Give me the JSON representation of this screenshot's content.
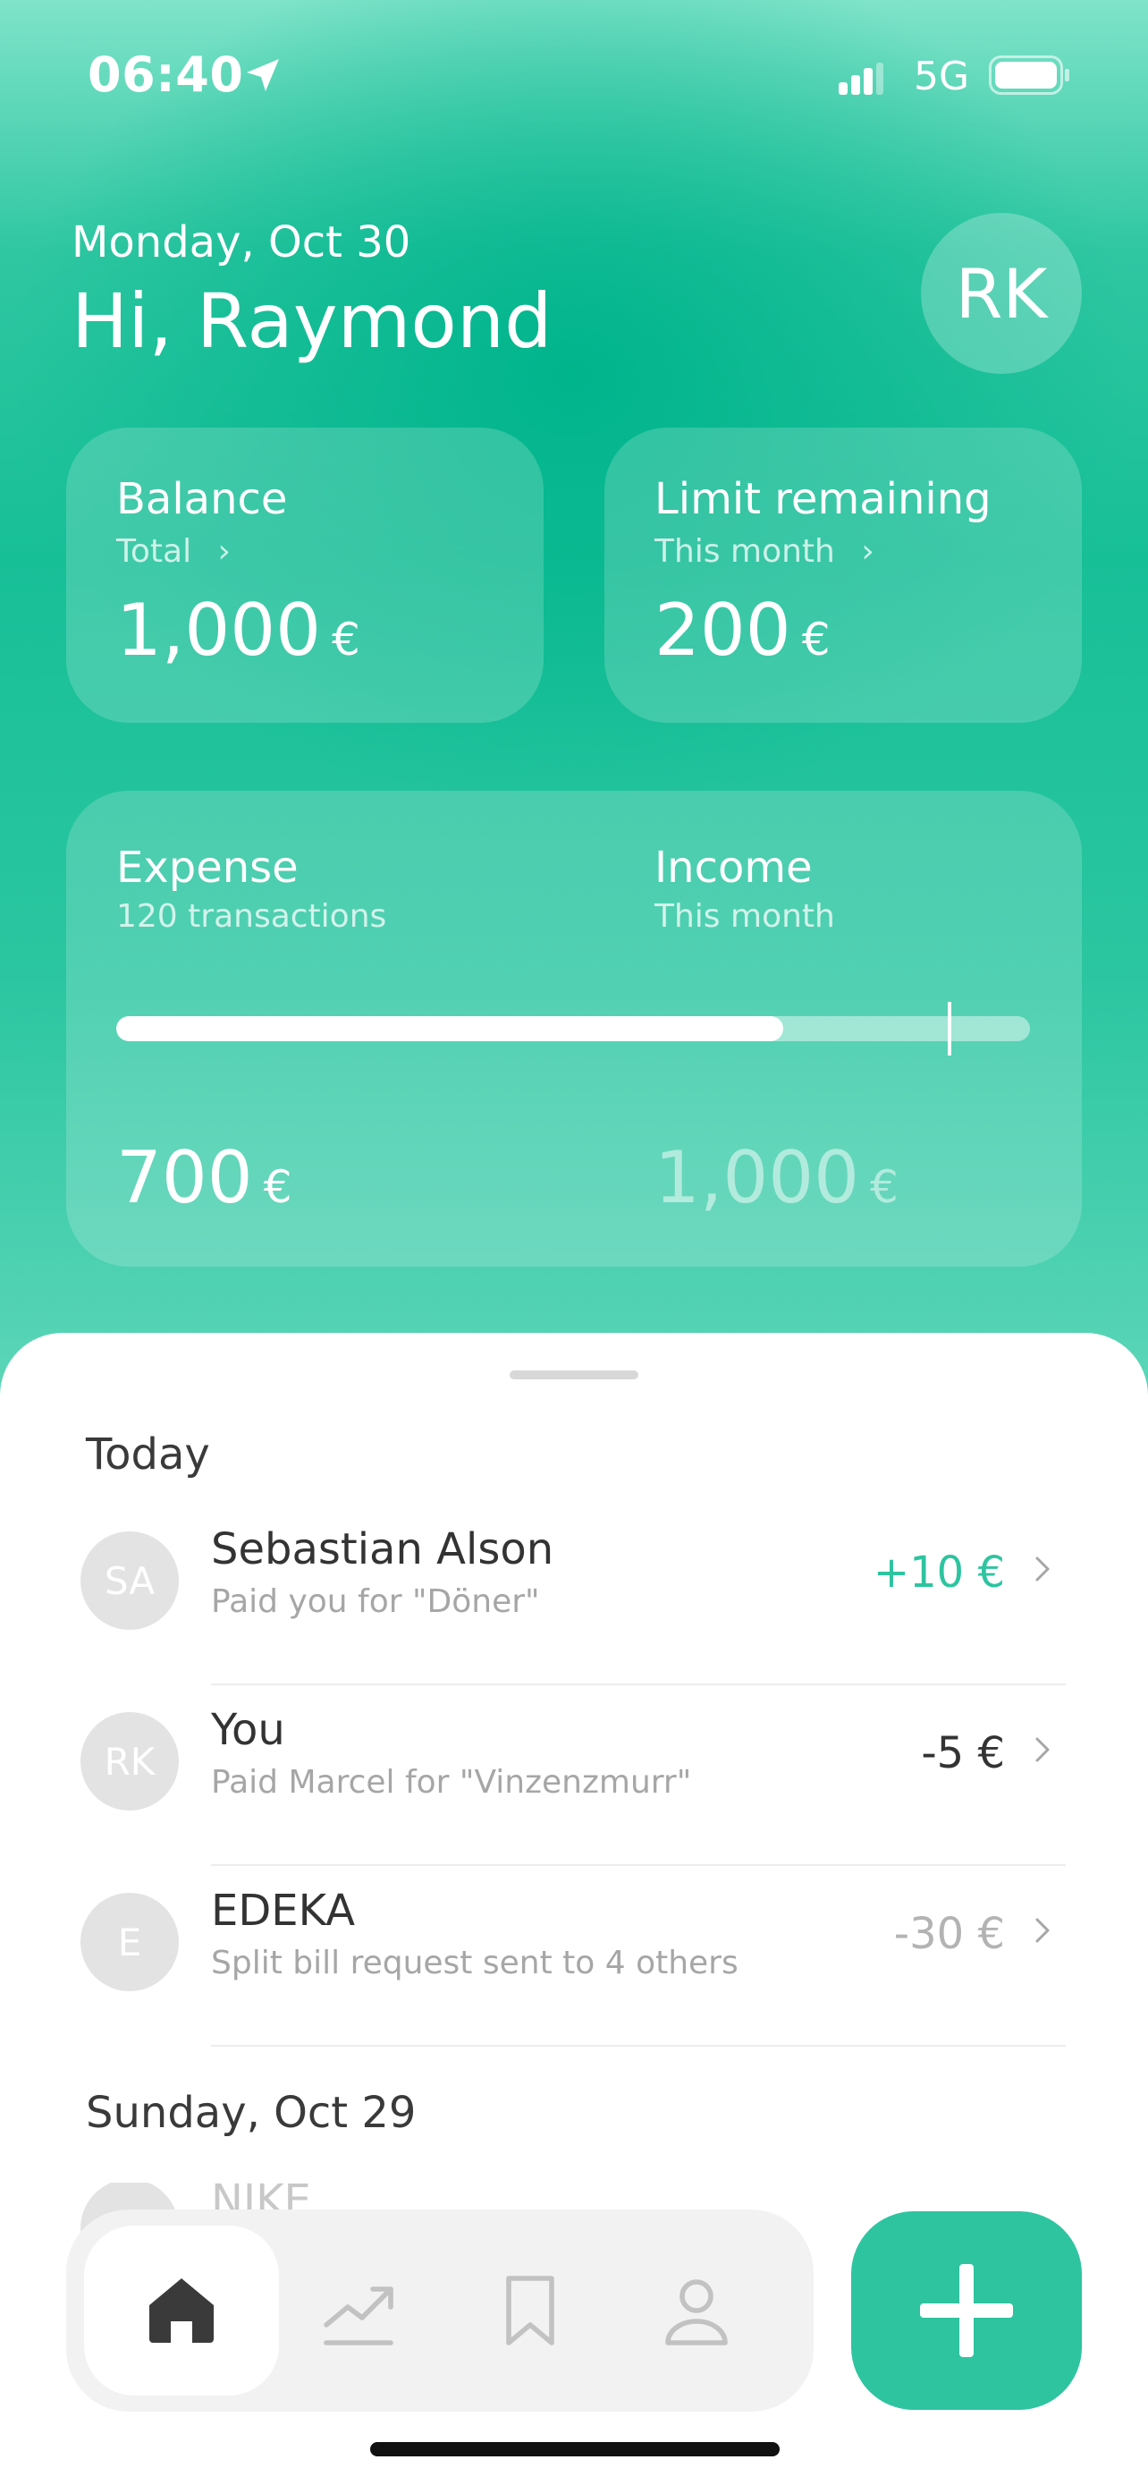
{
  "status_bar": {
    "time": "06:40",
    "network": "5G"
  },
  "header": {
    "date": "Monday, Oct 30",
    "greeting": "Hi, Raymond",
    "avatar_initials": "RK"
  },
  "balance_card": {
    "title": "Balance",
    "subtitle": "Total",
    "amount": "1,000",
    "currency": "€"
  },
  "limit_card": {
    "title": "Limit remaining",
    "subtitle": "This month",
    "amount": "200",
    "currency": "€"
  },
  "summary_card": {
    "expense_title": "Expense",
    "expense_subtitle": "120 transactions",
    "expense_amount": "700",
    "income_title": "Income",
    "income_subtitle": "This month",
    "income_amount": "1,000",
    "currency": "€",
    "expense_fraction": 0.73,
    "marker_fraction": 0.91
  },
  "feed": {
    "sections": [
      {
        "title": "Today",
        "transactions": [
          {
            "initials": "SA",
            "name": "Sebastian Alson",
            "description": "Paid you for \"Döner\"",
            "amount": "+10 €",
            "tone": "positive"
          },
          {
            "initials": "RK",
            "name": "You",
            "description": "Paid Marcel for \"Vinzenzmurr\"",
            "amount": "-5 €",
            "tone": "negative"
          },
          {
            "initials": "E",
            "name": "EDEKA",
            "description": "Split bill request sent to 4 others",
            "amount": "-30 €",
            "tone": "muted"
          }
        ]
      },
      {
        "title": "Sunday, Oct 29",
        "peek_name": "NIKE"
      }
    ]
  },
  "nav": {
    "items": [
      "home-icon",
      "trend-icon",
      "bookmark-icon",
      "profile-icon"
    ],
    "active": "home-icon"
  },
  "colors": {
    "accent": "#2ec4a0",
    "positive": "#2ec4a0",
    "muted": "#b3b3b3"
  }
}
